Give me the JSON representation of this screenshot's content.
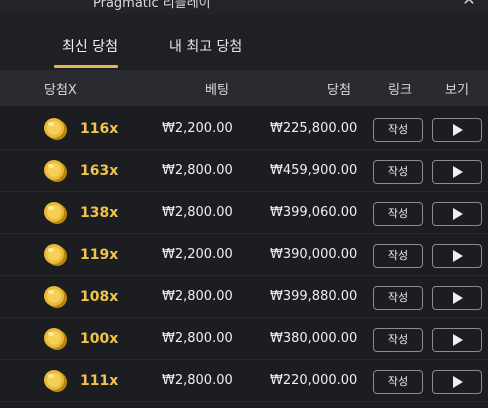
{
  "window": {
    "title": "Pragmatic 리플레이",
    "close_icon": "close-icon"
  },
  "tabs": [
    {
      "label": "최신 당첨",
      "active": true
    },
    {
      "label": "내 최고 당첨",
      "active": false
    }
  ],
  "colors": {
    "accent": "#e2b64a",
    "multiplier": "#f0c44a",
    "background": "#1b1c20"
  },
  "table": {
    "headers": {
      "multiplier": "당첨X",
      "bet": "베팅",
      "win": "당첨",
      "link": "링크",
      "view": "보기"
    },
    "write_label": "작성",
    "rows": [
      {
        "multiplier": "116x",
        "bet": "₩2,200.00",
        "win": "₩225,800.00"
      },
      {
        "multiplier": "163x",
        "bet": "₩2,800.00",
        "win": "₩459,900.00"
      },
      {
        "multiplier": "138x",
        "bet": "₩2,800.00",
        "win": "₩399,060.00"
      },
      {
        "multiplier": "119x",
        "bet": "₩2,200.00",
        "win": "₩390,000.00"
      },
      {
        "multiplier": "108x",
        "bet": "₩2,800.00",
        "win": "₩399,880.00"
      },
      {
        "multiplier": "100x",
        "bet": "₩2,800.00",
        "win": "₩380,000.00"
      },
      {
        "multiplier": "111x",
        "bet": "₩2,800.00",
        "win": "₩220,000.00"
      }
    ]
  }
}
